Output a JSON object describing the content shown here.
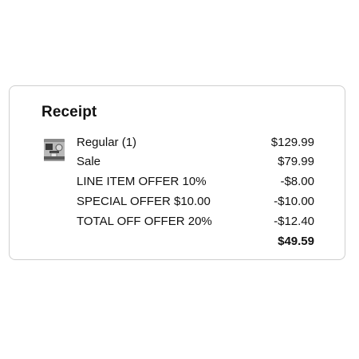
{
  "receipt": {
    "title": "Receipt",
    "product_image": "espresso-machine-thumbnail",
    "lines": [
      {
        "label": "Regular (1)",
        "amount": "$129.99"
      },
      {
        "label": "Sale",
        "amount": "$79.99"
      },
      {
        "label": "LINE ITEM OFFER 10%",
        "amount": "-$8.00"
      },
      {
        "label": "SPECIAL OFFER $10.00",
        "amount": "-$10.00"
      },
      {
        "label": "TOTAL OFF OFFER 20%",
        "amount": "-$12.40"
      }
    ],
    "total": "$49.59"
  }
}
